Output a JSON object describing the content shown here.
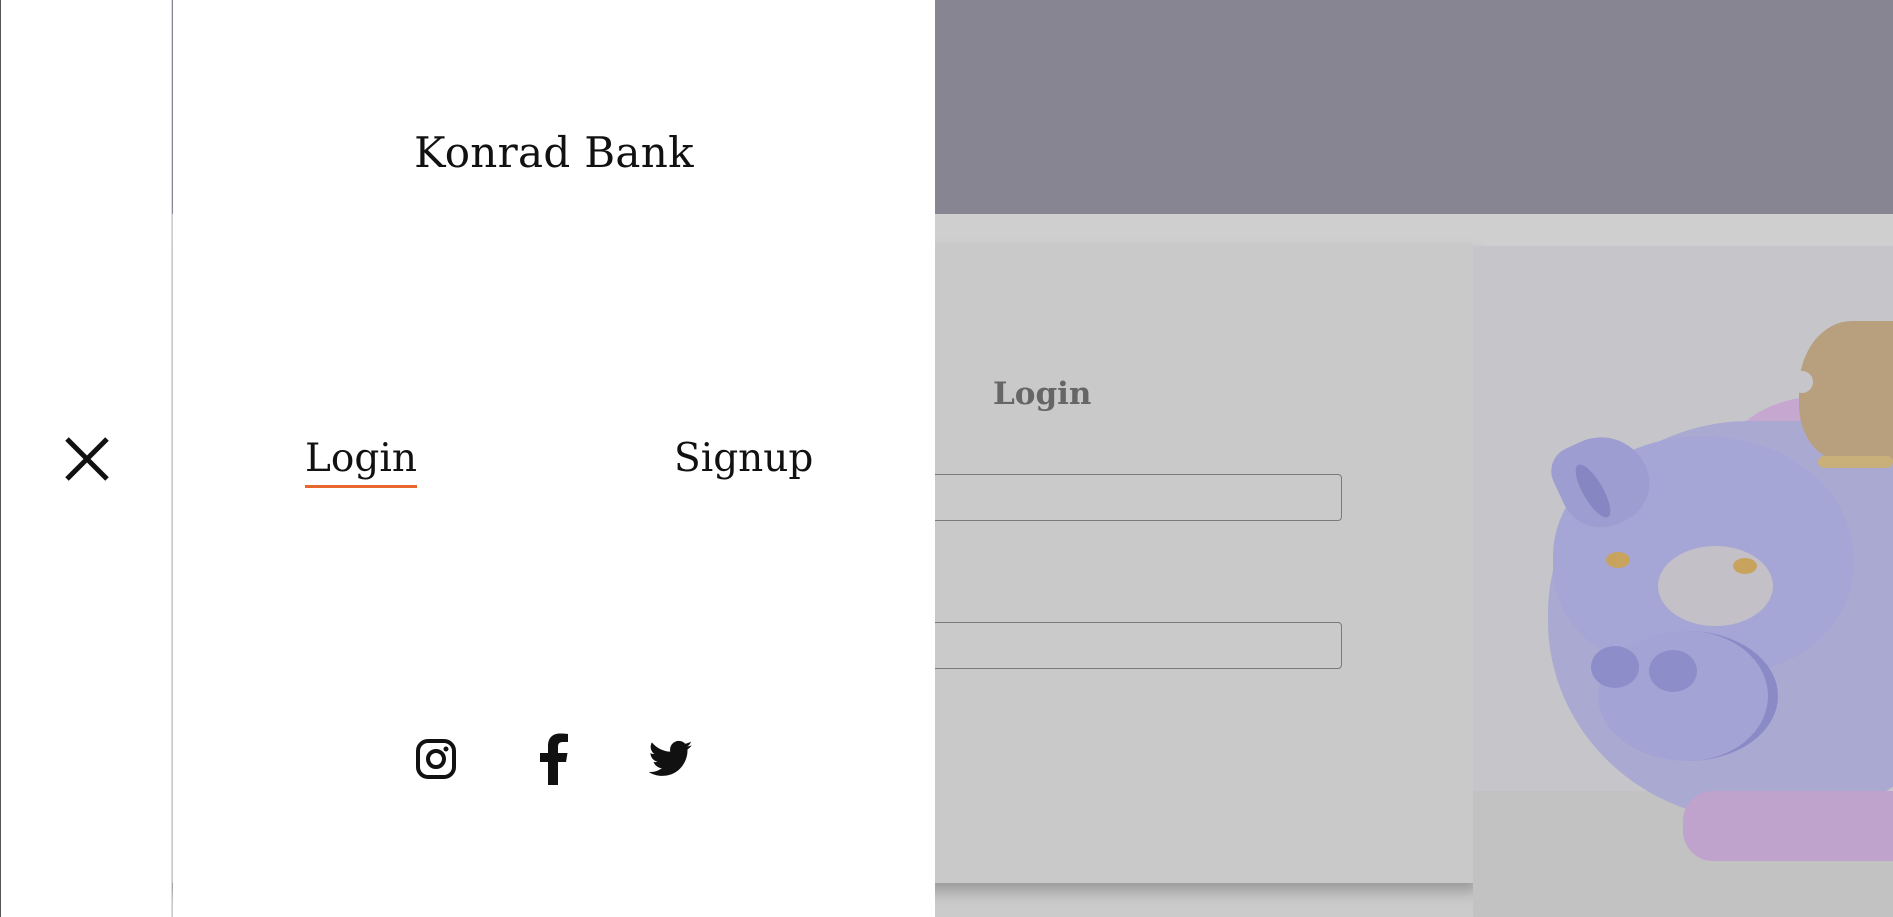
{
  "background": {
    "form_title": "Login",
    "colors": {
      "header": "#868591",
      "overlay_gray": "#cbcbcb"
    }
  },
  "drawer": {
    "brand": "Konrad Bank",
    "close_icon": "close-icon",
    "nav": [
      {
        "label": "Login",
        "active": true
      },
      {
        "label": "Signup",
        "active": false
      }
    ],
    "social": [
      {
        "name": "instagram-icon"
      },
      {
        "name": "facebook-icon"
      },
      {
        "name": "twitter-icon"
      }
    ],
    "accent_color": "#e8672d"
  }
}
